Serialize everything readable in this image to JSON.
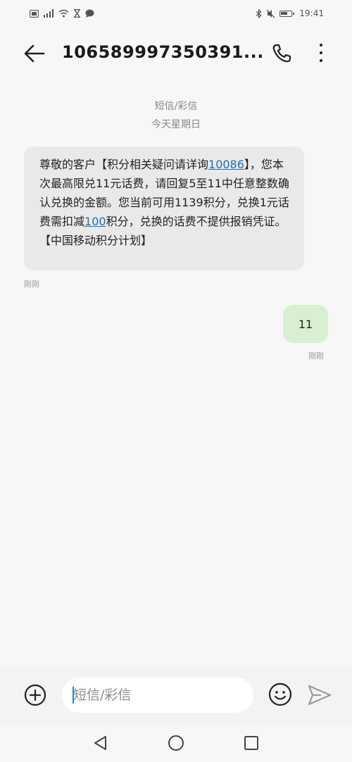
{
  "status_bar": {
    "time": "19:41",
    "left_icons": [
      "sim-icon",
      "signal-icon",
      "wifi-icon",
      "hourglass-icon",
      "chat-icon"
    ],
    "right_icons": [
      "bluetooth-icon",
      "mute-icon",
      "battery-icon"
    ]
  },
  "header": {
    "title": "106589997350391..."
  },
  "conversation": {
    "type_label": "短信/彩信",
    "date_label": "今天星期日"
  },
  "messages": [
    {
      "direction": "incoming",
      "text_1": "尊敬的客户【积分相关疑问请详询",
      "link_1": "10086",
      "text_2": "】，您本次最高限兑11元话费，请回复5至11中任意整数确认兑换的金额。您当前可用1139积分，兑换1元话费需扣减",
      "link_2": "100",
      "text_3": "积分，兑换的话费不提供报销凭证。【中国移动积分计划】",
      "time": "刚刚"
    },
    {
      "direction": "outgoing",
      "text": "11",
      "time": "刚刚"
    }
  ],
  "input": {
    "placeholder": "短信/彩信"
  },
  "colors": {
    "incoming_bubble": "#e9e9e9",
    "outgoing_bubble": "#d8f0d2",
    "link": "#1f6fb5"
  }
}
